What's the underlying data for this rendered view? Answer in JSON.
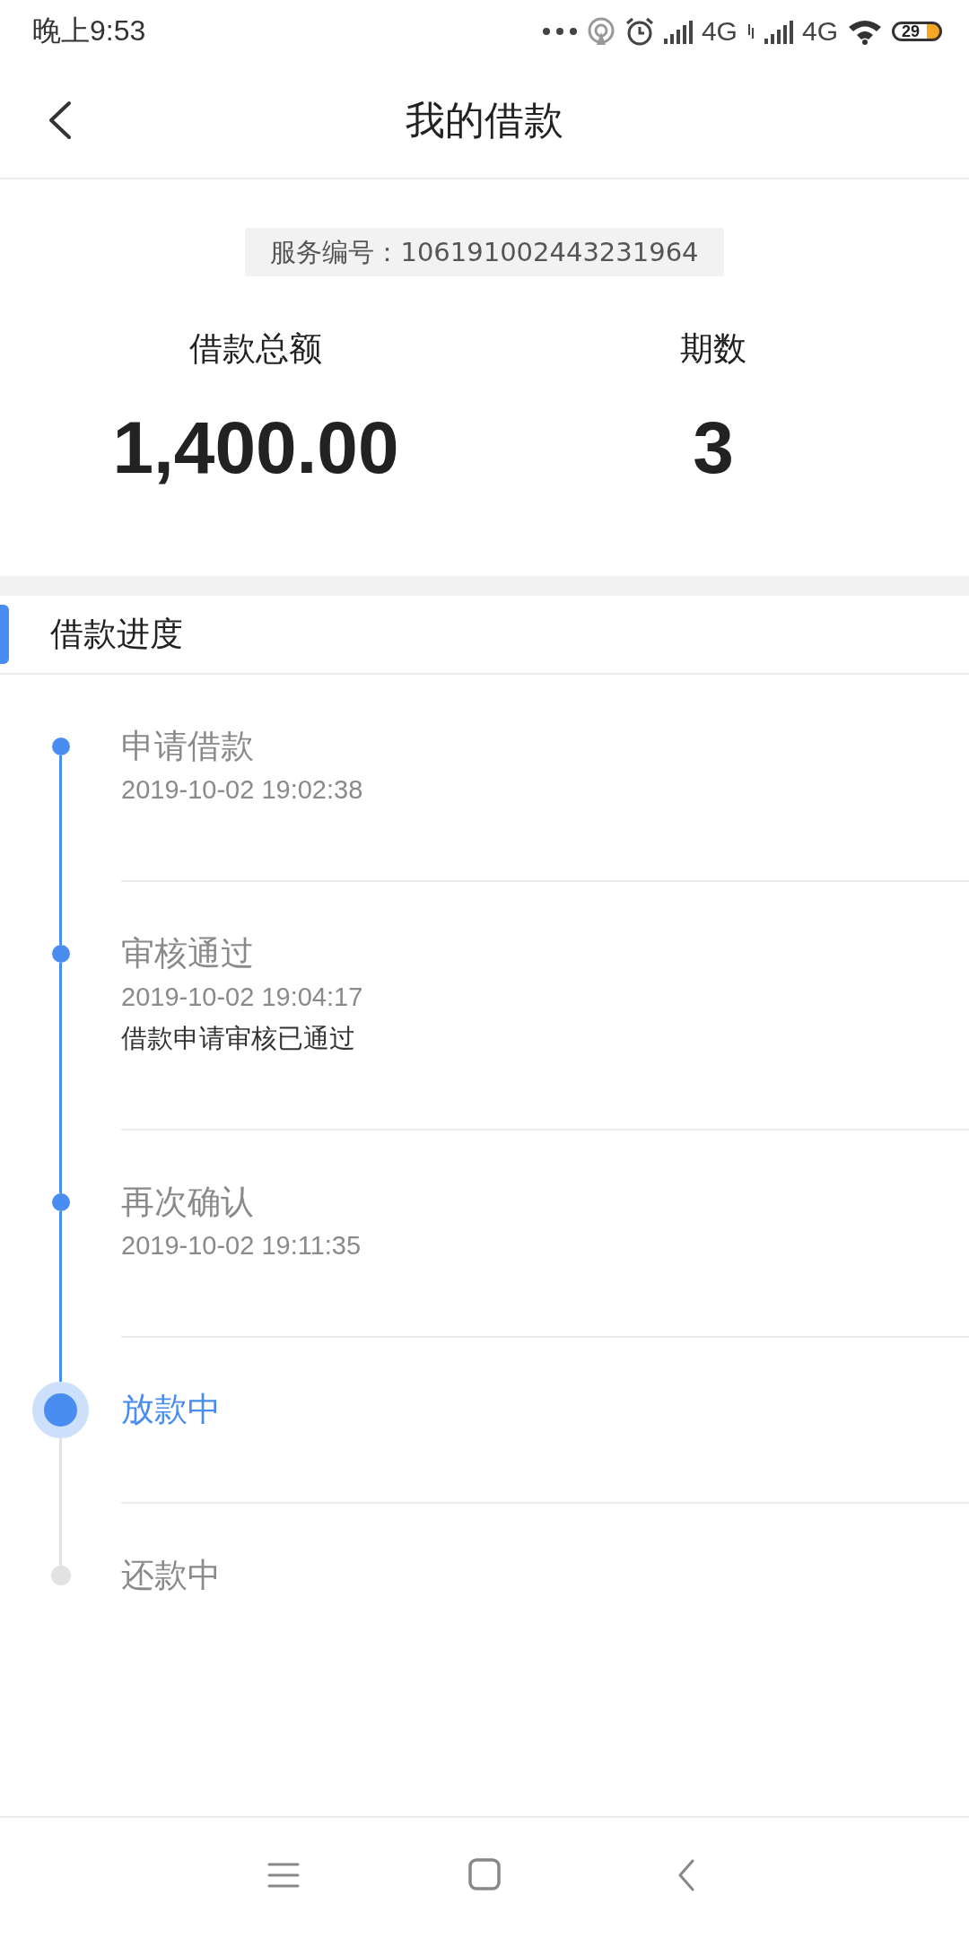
{
  "status_bar": {
    "time": "晚上9:53",
    "networks": [
      "4G",
      "4G"
    ],
    "battery": "29"
  },
  "header": {
    "title": "我的借款"
  },
  "service_number": "服务编号：106191002443231964",
  "summary": [
    {
      "label": "借款总额",
      "value": "1,400.00"
    },
    {
      "label": "期数",
      "value": "3"
    }
  ],
  "section": {
    "title": "借款进度"
  },
  "steps": [
    {
      "title": "申请借款",
      "time": "2019-10-02 19:02:38",
      "kind": "done"
    },
    {
      "title": "审核通过",
      "time": "2019-10-02 19:04:17",
      "note": "借款申请审核已通过",
      "kind": "done"
    },
    {
      "title": "再次确认",
      "time": "2019-10-02 19:11:35",
      "kind": "done"
    },
    {
      "title": "放款中",
      "kind": "current"
    },
    {
      "title": "还款中",
      "kind": "pending"
    }
  ]
}
